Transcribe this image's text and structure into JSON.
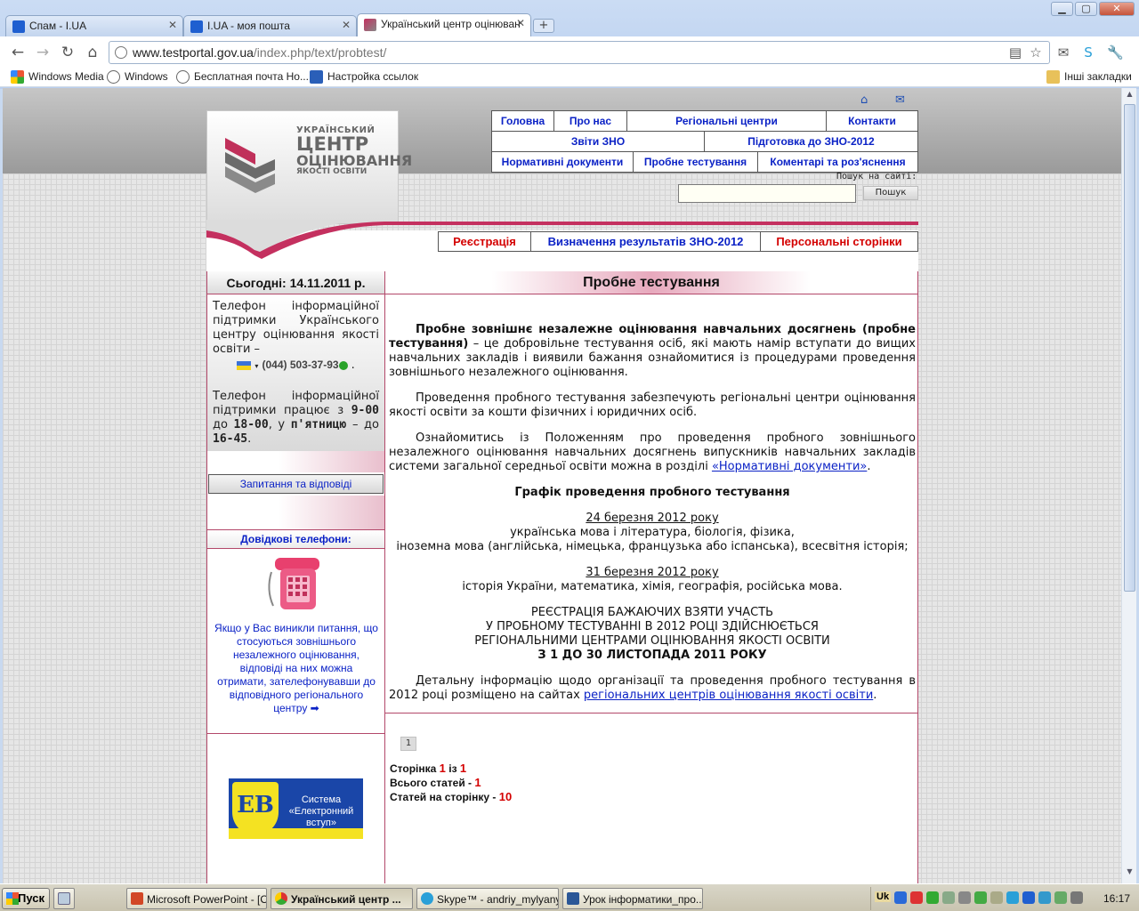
{
  "browser": {
    "tabs": [
      {
        "label": "Спам - I.UA",
        "active": false,
        "icon": "iua-favicon"
      },
      {
        "label": "I.UA - моя пошта",
        "active": false,
        "icon": "iua-favicon"
      },
      {
        "label": "Український центр оцінюван",
        "active": true,
        "icon": "ucoz-favicon"
      }
    ],
    "url_host": "www.testportal.gov.ua",
    "url_path": "/index.php/text/probtest/",
    "bookmarks": [
      "Windows Media",
      "Windows",
      "Бесплатная почта Но...",
      "Настройка ссылок"
    ],
    "other_bookmarks": "Інші закладки"
  },
  "site": {
    "logo": {
      "line1": "УКРАЇНСЬКИЙ",
      "line2": "ЦЕНТР",
      "line3": "ОЦІНЮВАННЯ",
      "line4": "ЯКОСТІ ОСВІТИ"
    },
    "nav_row1": [
      "Головна",
      "Про нас",
      "Регіональні центри",
      "Контакти"
    ],
    "nav_row2": [
      "Звіти ЗНО",
      "Підготовка до ЗНО-2012"
    ],
    "nav_row3": [
      "Нормативні документи",
      "Пробне тестування",
      "Коментарі та роз'яснення"
    ],
    "search_label": "Пошук на сайті:",
    "search_value": "",
    "search_button": "Пошук",
    "red_menu": {
      "register": "Реєстрація",
      "results": "Визначення результатів ЗНО-2012",
      "personal": "Персональні сторінки"
    },
    "colors": {
      "accent": "#b3486a",
      "link": "#0b22c6",
      "red": "#d40000"
    }
  },
  "sidebar": {
    "today": "Сьогодні: 14.11.2011 р.",
    "support_text1": "Телефон інформаційної підтримки Українського центру оцінювання якості освіти –",
    "phone": "(044) 503-37-93",
    "support_text2_a": "Телефон інформаційної підтримки працює з ",
    "hours_from": "9-00",
    "support_text2_b": " до ",
    "hours_to": "18-00",
    "support_text2_c": ", у ",
    "friday": "п'ятницю",
    "support_text2_d": " – до ",
    "friday_to": "16-45",
    "faq": "Запитання та відповіді",
    "ref_phones_title": "Довідкові телефони:",
    "ref_phones_text": "Якщо у Вас виникли питання, що стосуються зовнішнього незалежного оцінювання, відповіді на них можна отримати, зателефонувавши до відповідного регіонального центру",
    "ev_line1": "Система",
    "ev_line2": "«Електронний вступ»"
  },
  "main": {
    "title": "Пробне тестування",
    "p1_bold": "Пробне зовнішнє незалежне оцінювання навчальних досягнень (пробне тестування)",
    "p1_rest": " – це добровільне тестування осіб, які мають намір вступати до вищих навчальних закладів і виявили бажання ознайомитися із процедурами проведення зовнішнього незалежного оцінювання.",
    "p2": "Проведення пробного тестування забезпечують регіональні центри оцінювання якості освіти за кошти фізичних і юридичних осіб.",
    "p3_text": "Ознайомитись із Положенням про проведення пробного зовнішнього незалежного оцінювання навчальних досягнень випускників навчальних закладів системи загальної середньої освіти можна в розділі ",
    "p3_link": "«Нормативні документи»",
    "schedule_title": "Графік проведення пробного тестування",
    "date1": "24 березня 2012 року",
    "date1_subjects_a": "українська мова і література, біологія, фізика,",
    "date1_subjects_b": "іноземна мова (англійська, німецька, французька або іспанська), всесвітня історія;",
    "date2": "31 березня 2012 року",
    "date2_subjects": "історія України, математика, хімія, географія, російська мова.",
    "reg_line1": "РЕЄСТРАЦІЯ БАЖАЮЧИХ ВЗЯТИ УЧАСТЬ",
    "reg_line2": "У ПРОБНОМУ ТЕСТУВАННІ В 2012 РОЦІ ЗДІЙСНЮЄТЬСЯ",
    "reg_line3": "РЕГІОНАЛЬНИМИ ЦЕНТРАМИ ОЦІНЮВАННЯ ЯКОСТІ ОСВІТИ",
    "reg_line4": "З 1 ДО 30 ЛИСТОПАДА 2011 РОКУ",
    "p_last_text": "Детальну інформацію щодо організації та проведення пробного тестування в 2012 році розміщено на сайтах ",
    "p_last_link": "регіональних центрів оцінювання якості освіти",
    "pager_page": "1",
    "stat_page_label": "Сторінка",
    "stat_page": "1",
    "stat_of": "із",
    "stat_pages": "1",
    "stat_total_label": "Всього статей -",
    "stat_total": "1",
    "stat_per_label": "Статей на сторінку -",
    "stat_per": "10"
  },
  "taskbar": {
    "start": "Пуск",
    "buttons": [
      "Microsoft PowerPoint - [O...",
      "Український центр ...",
      "Skype™ - andriy_mylyanyk",
      "Урок інформатики_про..."
    ],
    "lang": "Uk",
    "clock": "16:17"
  }
}
